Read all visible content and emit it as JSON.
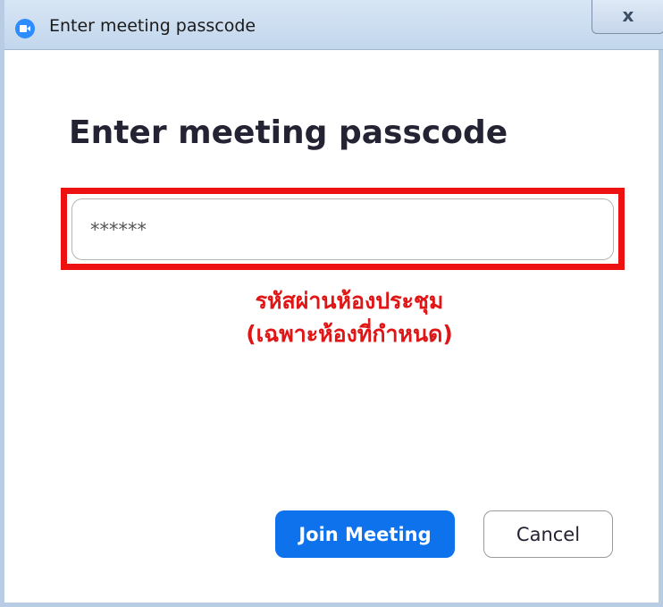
{
  "window": {
    "title": "Enter meeting passcode",
    "close_label": "x"
  },
  "dialog": {
    "heading": "Enter meeting passcode",
    "passcode_value": "******",
    "annotation_line1": "รหัสผ่านห้องประชุม",
    "annotation_line2": "(เฉพาะห้องที่กำหนด)",
    "join_label": "Join Meeting",
    "cancel_label": "Cancel"
  },
  "colors": {
    "primary_button": "#0e72ed",
    "annotation_red": "#e01515",
    "app_icon_blue": "#2d8cff"
  },
  "icons": {
    "app_icon": "zoom-camera-icon",
    "close_icon": "close-icon"
  }
}
